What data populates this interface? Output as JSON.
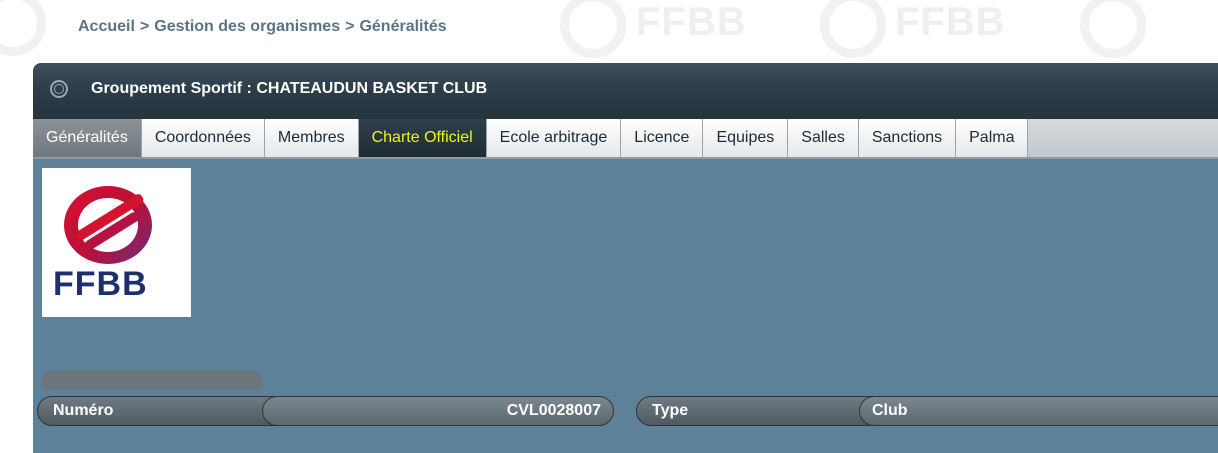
{
  "breadcrumb": [
    "Accueil",
    "Gestion des organismes",
    "Généralités"
  ],
  "breadcrumb_sep": ">",
  "panel": {
    "title": "Groupement Sportif : CHATEAUDUN BASKET CLUB",
    "icon": "basketball-icon"
  },
  "tabs": [
    {
      "label": "Généralités",
      "state": "active"
    },
    {
      "label": "Coordonnées",
      "state": "normal"
    },
    {
      "label": "Membres",
      "state": "normal"
    },
    {
      "label": "Charte Officiel",
      "state": "highlighted"
    },
    {
      "label": "Ecole arbitrage",
      "state": "normal"
    },
    {
      "label": "Licence",
      "state": "normal"
    },
    {
      "label": "Equipes",
      "state": "normal"
    },
    {
      "label": "Salles",
      "state": "normal"
    },
    {
      "label": "Sanctions",
      "state": "normal"
    },
    {
      "label": "Palma",
      "state": "normal"
    }
  ],
  "logo": {
    "text": "FFBB"
  },
  "watermark_text": "FFBB",
  "fields": {
    "numero": {
      "label": "Numéro",
      "value": "CVL0028007"
    },
    "type": {
      "label": "Type",
      "value": "Club"
    }
  },
  "colors": {
    "panel": "#5d8199",
    "highlight_text": "#f2f21a",
    "breadcrumb": "#5a7385"
  }
}
